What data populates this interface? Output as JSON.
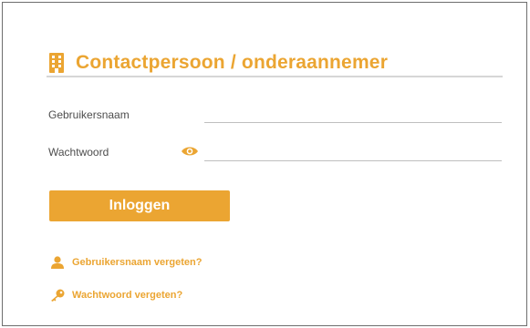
{
  "colors": {
    "accent": "#eba532",
    "label_text": "#4d4d4d",
    "divider": "#d6d6d6"
  },
  "header": {
    "icon": "building-icon",
    "title": "Contactpersoon / onderaannemer"
  },
  "form": {
    "username": {
      "label": "Gebruikersnaam",
      "value": ""
    },
    "password": {
      "label": "Wachtwoord",
      "value": "",
      "toggle_icon": "eye-icon"
    },
    "login_button": "Inloggen"
  },
  "links": {
    "forgot_username": {
      "icon": "user-icon",
      "label": "Gebruikersnaam vergeten?"
    },
    "forgot_password": {
      "icon": "key-icon",
      "label": "Wachtwoord vergeten?"
    }
  }
}
